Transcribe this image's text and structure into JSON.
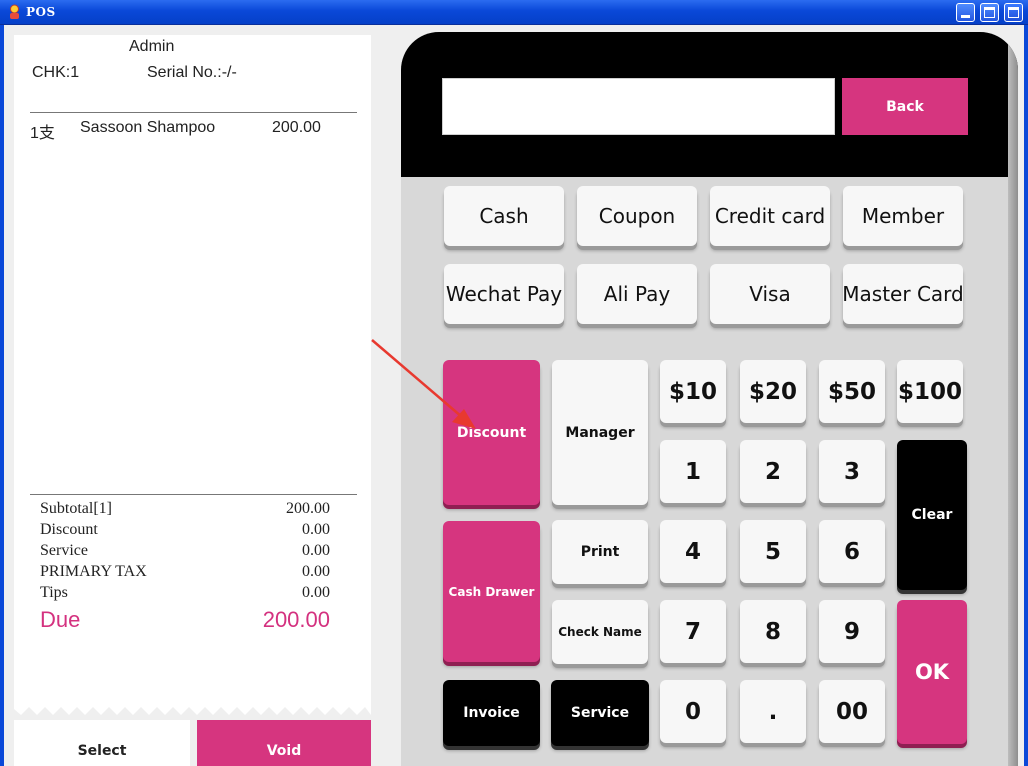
{
  "window": {
    "title": "POS"
  },
  "receipt": {
    "operator": "Admin",
    "check": "CHK:1",
    "serial": "Serial No.:-/-",
    "items": [
      {
        "qty": "1支",
        "name": "Sassoon Shampoo",
        "price": "200.00"
      }
    ],
    "summary": [
      {
        "label": "Subtotal[1]",
        "value": "200.00"
      },
      {
        "label": "Discount",
        "value": "0.00"
      },
      {
        "label": "Service",
        "value": "0.00"
      },
      {
        "label": "PRIMARY TAX",
        "value": "0.00"
      },
      {
        "label": "Tips",
        "value": "0.00"
      }
    ],
    "due_label": "Due",
    "due_value": "200.00"
  },
  "actions": {
    "select": "Select",
    "void": "Void"
  },
  "keypad": {
    "back": "Back",
    "payments_row1": [
      "Cash",
      "Coupon",
      "Credit card",
      "Member"
    ],
    "payments_row2": [
      "Wechat Pay",
      "Ali Pay",
      "Visa",
      "Master Card"
    ],
    "functions": {
      "discount": "Discount",
      "manager": "Manager",
      "cash_drawer": "Cash Drawer",
      "print": "Print",
      "check_name": "Check Name",
      "invoice": "Invoice",
      "service": "Service",
      "clear": "Clear",
      "ok": "OK"
    },
    "quick_amounts": [
      "$10",
      "$20",
      "$50",
      "$100"
    ],
    "digits": {
      "one": "1",
      "two": "2",
      "three": "3",
      "four": "4",
      "five": "5",
      "six": "6",
      "seven": "7",
      "eight": "8",
      "nine": "9",
      "zero": "0",
      "dot": ".",
      "double_zero": "00"
    }
  },
  "colors": {
    "accent": "#d6357f",
    "titlebar": "#0a48d8",
    "annotation_arrow": "#e8392f"
  },
  "icons": {
    "app": "pos-app-icon"
  }
}
